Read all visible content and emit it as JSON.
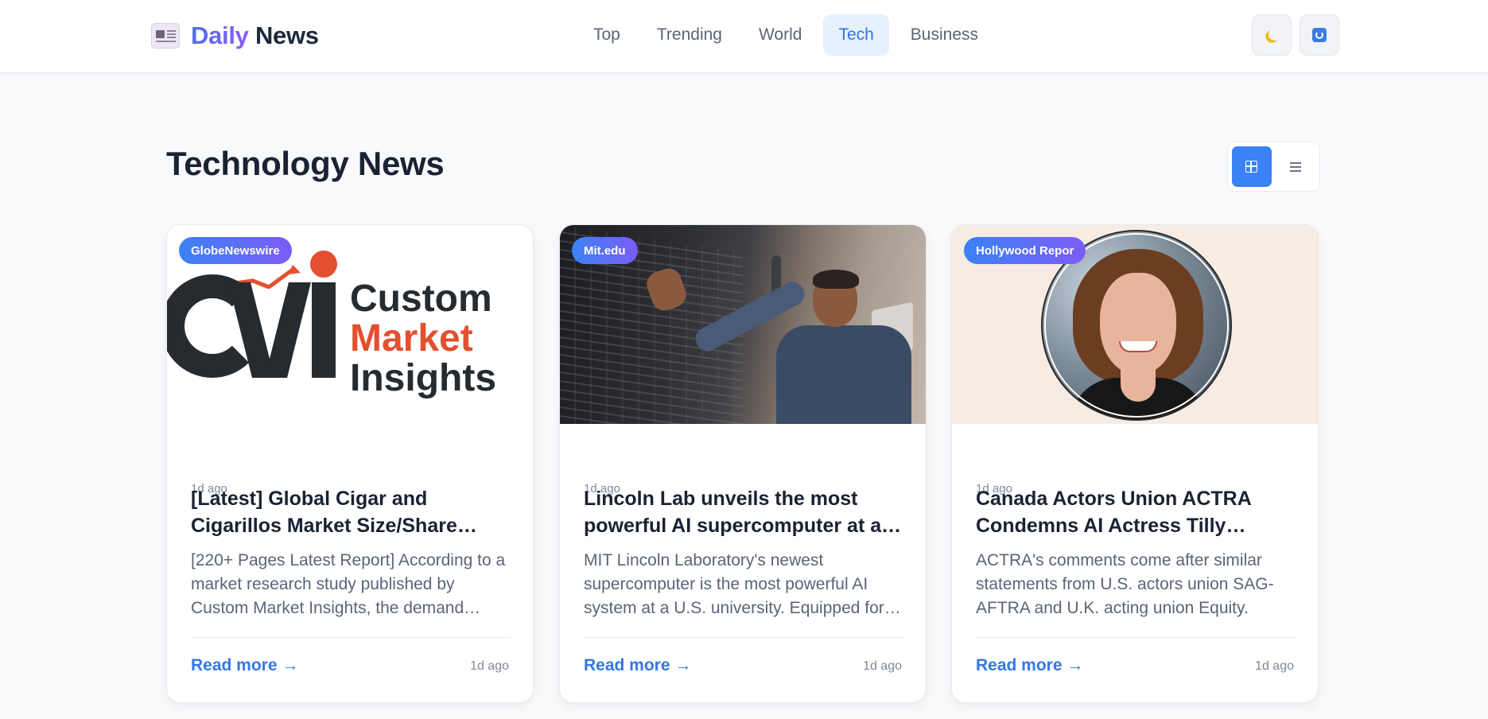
{
  "header": {
    "brand_word1": "Daily",
    "brand_word2": "News",
    "brand_icon": "newspaper-icon",
    "nav": [
      {
        "label": "Top",
        "active": false
      },
      {
        "label": "Trending",
        "active": false
      },
      {
        "label": "World",
        "active": false
      },
      {
        "label": "Tech",
        "active": true
      },
      {
        "label": "Business",
        "active": false
      }
    ],
    "theme_icon": "moon-icon",
    "refresh_icon": "refresh-icon"
  },
  "section": {
    "title": "Technology News",
    "view_modes": [
      {
        "icon": "grid-view-icon",
        "active": true
      },
      {
        "icon": "list-view-icon",
        "active": false
      }
    ]
  },
  "cards": [
    {
      "source": "GlobeNewswire",
      "time": "1d ago",
      "title": "[Latest] Global Cigar and Cigarillos Market Size/Share Worth",
      "description": "[220+ Pages Latest Report] According to a market research study published by Custom Market Insights, the demand analysis",
      "read_more": "Read more →",
      "footer_time": "1d ago",
      "image_text": {
        "line1": "Custom",
        "line2": "Market",
        "line3": "Insights"
      }
    },
    {
      "source": "Mit.edu",
      "time": "1d ago",
      "title": "Lincoln Lab unveils the most powerful AI supercomputer at any U.S. university",
      "description": "MIT Lincoln Laboratory's newest supercomputer is the most powerful AI system at a U.S. university. Equipped for generative AI",
      "read_more": "Read more →",
      "footer_time": "1d ago"
    },
    {
      "source": "Hollywood Repor",
      "time": "1d ago",
      "title": "Canada Actors Union ACTRA Condemns AI Actress Tilly Norwood",
      "description": "ACTRA's comments come after similar statements from U.S. actors union SAG-AFTRA and U.K. acting union Equity.",
      "read_more": "Read more →",
      "footer_time": "1d ago"
    }
  ],
  "colors": {
    "accent": "#3b82f6",
    "nav_active_bg": "#e7f0fd",
    "badge_gradient_start": "#3b82f6",
    "badge_gradient_end": "#7c5cf5",
    "page_bg": "#f8f9fb"
  }
}
